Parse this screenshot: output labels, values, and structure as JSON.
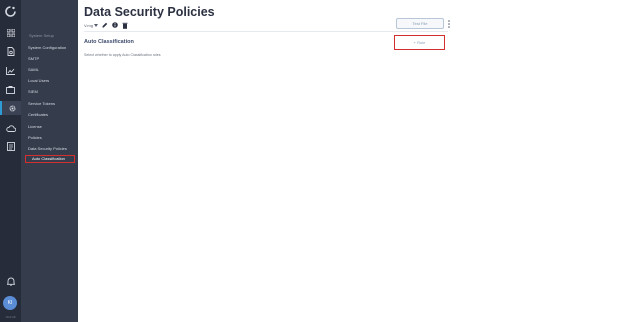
{
  "rail": {
    "avatar_initials": "KI",
    "version": "v6.0.19",
    "icons": [
      "logo-icon",
      "dashboard-icon",
      "reports-icon",
      "analytics-icon",
      "inventory-icon",
      "settings-icon",
      "cloud-icon",
      "list-icon",
      "notifications-icon"
    ],
    "accent_color": "#2e9bd6"
  },
  "sidebar": {
    "section_title": "System Setup",
    "items": [
      {
        "label": "System Configuration"
      },
      {
        "label": "SMTP"
      },
      {
        "label": "SAML"
      },
      {
        "label": "Local Users"
      },
      {
        "label": "SIEM"
      },
      {
        "label": "Service Tokens"
      },
      {
        "label": "Certificates"
      },
      {
        "label": "License"
      },
      {
        "label": "Policies"
      },
      {
        "label": "Data Security Policies"
      },
      {
        "label": "Auto Classification"
      }
    ],
    "selected_item": "Auto Classification"
  },
  "header": {
    "title": "Data Security Policies",
    "version_select": "V.mg"
  },
  "toolbar": {
    "test_file_label": "Test File"
  },
  "section": {
    "title": "Auto Classification",
    "description": "Select whether to apply Auto Classification rules"
  },
  "add_rule": {
    "label": "+ Rule"
  },
  "colors": {
    "highlight": "#d32f2f",
    "rail_bg": "#262c3a",
    "sidebar_bg": "#353c4c"
  }
}
